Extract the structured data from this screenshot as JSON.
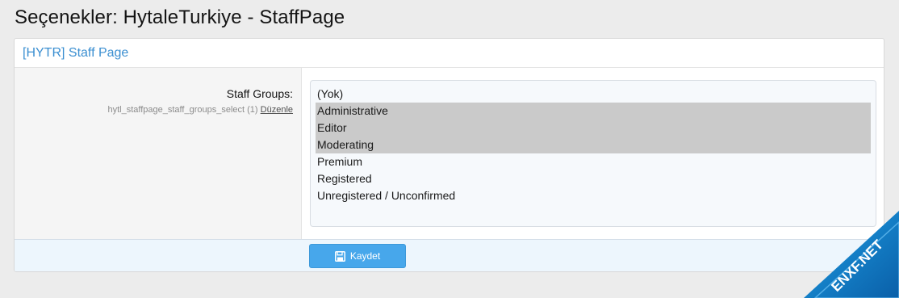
{
  "page": {
    "title": "Seçenekler: HytaleTurkiye - StaffPage"
  },
  "block": {
    "title": "[HYTR] Staff Page"
  },
  "option": {
    "label": "Staff Groups:",
    "hint_id": "hytl_staffpage_staff_groups_select (1)",
    "edit_link": "Düzenle",
    "select_items": [
      {
        "label": "(Yok)",
        "selected": false
      },
      {
        "label": "Administrative",
        "selected": true
      },
      {
        "label": "Editor",
        "selected": true
      },
      {
        "label": "Moderating",
        "selected": true
      },
      {
        "label": "Premium",
        "selected": false
      },
      {
        "label": "Registered",
        "selected": false
      },
      {
        "label": "Unregistered / Unconfirmed",
        "selected": false
      }
    ]
  },
  "footer": {
    "save_label": "Kaydet",
    "save_icon": "save-icon"
  },
  "watermark": {
    "text": "ENXF.NET",
    "icon": "watermark-triangle"
  },
  "colors": {
    "accent": "#3b8fd1",
    "button": "#47a7eb",
    "selected_bg": "#cacaca",
    "footer_bg": "#edf6fd"
  }
}
